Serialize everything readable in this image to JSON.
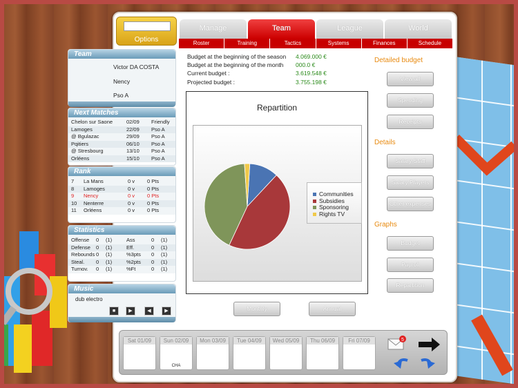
{
  "options": {
    "label": "Options",
    "field_value": ""
  },
  "tabs": [
    {
      "label": "Manage"
    },
    {
      "label": "Team"
    },
    {
      "label": "League"
    },
    {
      "label": "World"
    }
  ],
  "subnav": [
    "Roster",
    "Training",
    "Tactics",
    "Systems",
    "Finances",
    "Schedule"
  ],
  "budget": {
    "rows": [
      {
        "label": "Budget at the beginning of the season",
        "value": "4.069.000 €"
      },
      {
        "label": "Budget at the beginning of the month",
        "value": "000.0 €"
      },
      {
        "label": "Current budget :",
        "value": "3.619.548 €"
      },
      {
        "label": "Projected budget :",
        "value": "3.755.198 €"
      }
    ]
  },
  "side": {
    "detailed_budget": "Detailed budget",
    "view_all": "View all",
    "spending": "Spending",
    "receipts": "Receipts",
    "details": "Details",
    "salary_staff": "Salary Staff",
    "salary_players": "Salary Players",
    "other_expenses": "Other expenses",
    "graphs": "Graphs",
    "g_budget": "Budget",
    "g_payroll": "Payroll",
    "g_repartition": "Repartition"
  },
  "chart_data": {
    "type": "pie",
    "title": "Repartition",
    "categories": [
      "Communities",
      "Subsidies",
      "Sponsoring",
      "Rights TV"
    ],
    "values": [
      11,
      45,
      42,
      2
    ],
    "colors": [
      "#4a74b3",
      "#a8383a",
      "#7f955a",
      "#f0c94a"
    ],
    "legend_position": "right"
  },
  "buttons": {
    "monthly": "Monthly",
    "annual": "Annual"
  },
  "team_panel": {
    "title": "Team",
    "coach": "Victor DA COSTA",
    "club": "Nency",
    "league": "Pso A"
  },
  "next_matches": {
    "title": "Next Matches",
    "rows": [
      {
        "team": "Chelon sur Saone",
        "date": "02/09",
        "comp": "Friendly"
      },
      {
        "team": "Lamoges",
        "date": "22/09",
        "comp": "Pso A"
      },
      {
        "team": "@ Bgulazac",
        "date": "29/09",
        "comp": "Pso A"
      },
      {
        "team": "Pqitiers",
        "date": "06/10",
        "comp": "Pso A"
      },
      {
        "team": "@ Stresbourg",
        "date": "13/10",
        "comp": "Pso A"
      },
      {
        "team": "Orléens",
        "date": "15/10",
        "comp": "Pso A"
      }
    ]
  },
  "rank": {
    "title": "Rank",
    "rows": [
      {
        "pos": "7",
        "team": "La Mans",
        "v": "0 v",
        "pts": "0 Pts"
      },
      {
        "pos": "8",
        "team": "Lamoges",
        "v": "0 v",
        "pts": "0 Pts"
      },
      {
        "pos": "9",
        "team": "Nency",
        "v": "0 v",
        "pts": "0 Pts"
      },
      {
        "pos": "10",
        "team": "Nenterre",
        "v": "0 v",
        "pts": "0 Pts"
      },
      {
        "pos": "11",
        "team": "Orléens",
        "v": "0 v",
        "pts": "0 Pts"
      }
    ]
  },
  "stats": {
    "title": "Statistics",
    "rows": [
      {
        "a": "Offense",
        "b": "0",
        "c": "(1)",
        "d": "Ass",
        "e": "0",
        "f": "(1)"
      },
      {
        "a": "Defense",
        "b": "0",
        "c": "(1)",
        "d": "Eff.",
        "e": "0",
        "f": "(1)"
      },
      {
        "a": "Rebounds",
        "b": "0",
        "c": "(1)",
        "d": "%3pts",
        "e": "0",
        "f": "(1)"
      },
      {
        "a": "Steal.",
        "b": "0",
        "c": "(1)",
        "d": "%2pts",
        "e": "0",
        "f": "(1)"
      },
      {
        "a": "Turnov.",
        "b": "0",
        "c": "(1)",
        "d": "%Ft",
        "e": "0",
        "f": "(1)"
      }
    ]
  },
  "music": {
    "title": "Music",
    "track": "dub electro"
  },
  "calendar": {
    "days": [
      {
        "label": "Sat 01/09",
        "event": ""
      },
      {
        "label": "Sun 02/09",
        "event": "CHA"
      },
      {
        "label": "Mon 03/09",
        "event": ""
      },
      {
        "label": "Tue 04/09",
        "event": ""
      },
      {
        "label": "Wed 05/09",
        "event": ""
      },
      {
        "label": "Thu 06/09",
        "event": ""
      },
      {
        "label": "Fri 07/09",
        "event": ""
      }
    ],
    "mail_count": "5"
  }
}
